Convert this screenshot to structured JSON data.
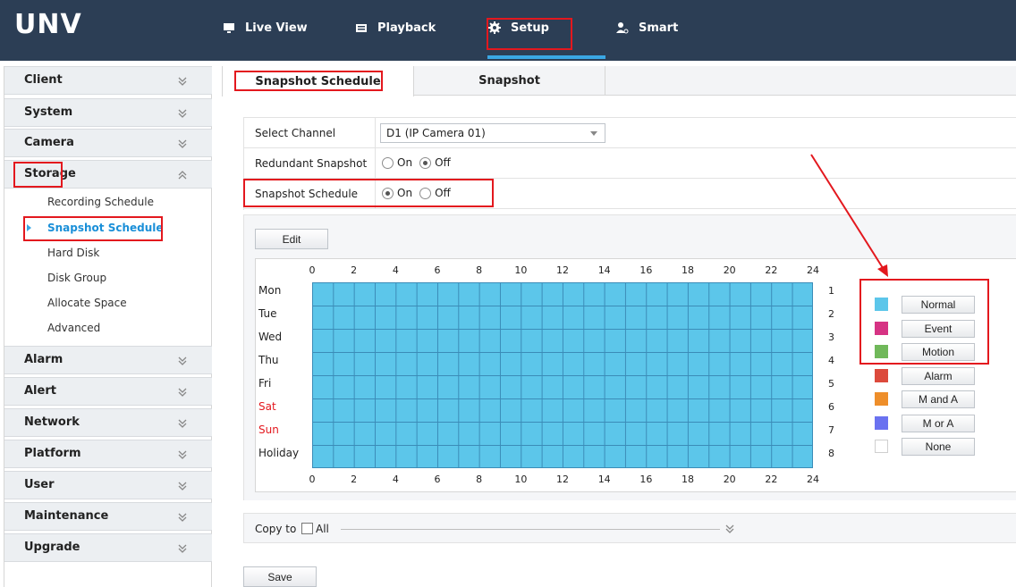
{
  "brand": {
    "logo_text": "UNV"
  },
  "nav": {
    "items": [
      {
        "label": "Live View",
        "icon": "monitor-icon"
      },
      {
        "label": "Playback",
        "icon": "film-icon"
      },
      {
        "label": "Setup",
        "icon": "gear-icon"
      },
      {
        "label": "Smart",
        "icon": "person-icon"
      }
    ],
    "active": "Setup"
  },
  "sidebar": {
    "groups": [
      {
        "label": "Client",
        "expanded": false
      },
      {
        "label": "System",
        "expanded": false
      },
      {
        "label": "Camera",
        "expanded": false
      },
      {
        "label": "Storage",
        "expanded": true
      },
      {
        "label": "Alarm",
        "expanded": false
      },
      {
        "label": "Alert",
        "expanded": false
      },
      {
        "label": "Network",
        "expanded": false
      },
      {
        "label": "Platform",
        "expanded": false
      },
      {
        "label": "User",
        "expanded": false
      },
      {
        "label": "Maintenance",
        "expanded": false
      },
      {
        "label": "Upgrade",
        "expanded": false
      }
    ],
    "storage_items": [
      {
        "label": "Recording Schedule"
      },
      {
        "label": "Snapshot Schedule",
        "active": true
      },
      {
        "label": "Hard Disk"
      },
      {
        "label": "Disk Group"
      },
      {
        "label": "Allocate Space"
      },
      {
        "label": "Advanced"
      }
    ]
  },
  "tabs": [
    {
      "label": "Snapshot Schedule",
      "active": true
    },
    {
      "label": "Snapshot",
      "active": false
    }
  ],
  "form": {
    "channel": {
      "label": "Select Channel",
      "value": "D1 (IP Camera 01)"
    },
    "redundant": {
      "label": "Redundant Snapshot",
      "on_label": "On",
      "off_label": "Off",
      "selected": "Off"
    },
    "schedule": {
      "label": "Snapshot Schedule",
      "on_label": "On",
      "off_label": "Off",
      "selected": "On"
    }
  },
  "schedule": {
    "edit_label": "Edit",
    "hour_labels": [
      "0",
      "2",
      "4",
      "6",
      "8",
      "10",
      "12",
      "14",
      "16",
      "18",
      "20",
      "22",
      "24"
    ],
    "days": [
      {
        "label": "Mon",
        "weekend": false
      },
      {
        "label": "Tue",
        "weekend": false
      },
      {
        "label": "Wed",
        "weekend": false
      },
      {
        "label": "Thu",
        "weekend": false
      },
      {
        "label": "Fri",
        "weekend": false
      },
      {
        "label": "Sat",
        "weekend": true
      },
      {
        "label": "Sun",
        "weekend": true
      },
      {
        "label": "Holiday",
        "weekend": false
      }
    ],
    "row_numbers": [
      "1",
      "2",
      "3",
      "4",
      "5",
      "6",
      "7",
      "8"
    ],
    "fill_mode": "Normal",
    "legend": [
      {
        "label": "Normal",
        "color": "#5cc6ea"
      },
      {
        "label": "Event",
        "color": "#d63384"
      },
      {
        "label": "Motion",
        "color": "#70b85a"
      },
      {
        "label": "Alarm",
        "color": "#dc4a3c"
      },
      {
        "label": "M and A",
        "color": "#ee8e2a"
      },
      {
        "label": "M or A",
        "color": "#6a72f0"
      },
      {
        "label": "None",
        "color": "#ffffff"
      }
    ]
  },
  "copy": {
    "label": "Copy to",
    "all_label": "All",
    "all_checked": false
  },
  "save_label": "Save",
  "colors": {
    "topbar": "#2c3e55",
    "accent": "#3aa7e4",
    "annotation": "#e3181e",
    "active_link": "#1a8fd8"
  }
}
